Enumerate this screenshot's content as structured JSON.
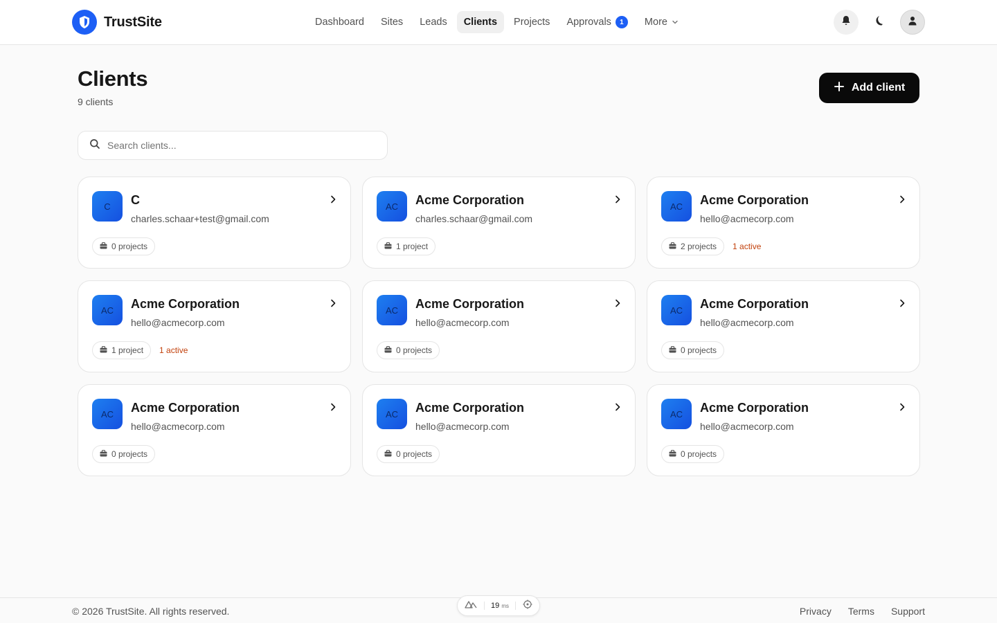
{
  "brand": {
    "name": "TrustSite",
    "accent": "#1d5ff5"
  },
  "nav": {
    "items": [
      {
        "label": "Dashboard",
        "active": false
      },
      {
        "label": "Sites",
        "active": false
      },
      {
        "label": "Leads",
        "active": false
      },
      {
        "label": "Clients",
        "active": true
      },
      {
        "label": "Projects",
        "active": false
      },
      {
        "label": "Approvals",
        "active": false,
        "badge": "1"
      },
      {
        "label": "More",
        "active": false,
        "dropdown": true
      }
    ]
  },
  "header_icons": [
    "bell-icon",
    "moon-icon",
    "user-icon"
  ],
  "page": {
    "title": "Clients",
    "count": "9 clients",
    "add_button": "Add client",
    "search_placeholder": "Search clients..."
  },
  "clients": [
    {
      "initials": "C",
      "name": "C",
      "email": "charles.schaar+test@gmail.com",
      "projects": "0 projects",
      "active": ""
    },
    {
      "initials": "AC",
      "name": "Acme Corporation",
      "email": "charles.schaar@gmail.com",
      "projects": "1 project",
      "active": ""
    },
    {
      "initials": "AC",
      "name": "Acme Corporation",
      "email": "hello@acmecorp.com",
      "projects": "2 projects",
      "active": "1 active"
    },
    {
      "initials": "AC",
      "name": "Acme Corporation",
      "email": "hello@acmecorp.com",
      "projects": "1 project",
      "active": "1 active"
    },
    {
      "initials": "AC",
      "name": "Acme Corporation",
      "email": "hello@acmecorp.com",
      "projects": "0 projects",
      "active": ""
    },
    {
      "initials": "AC",
      "name": "Acme Corporation",
      "email": "hello@acmecorp.com",
      "projects": "0 projects",
      "active": ""
    },
    {
      "initials": "AC",
      "name": "Acme Corporation",
      "email": "hello@acmecorp.com",
      "projects": "0 projects",
      "active": ""
    },
    {
      "initials": "AC",
      "name": "Acme Corporation",
      "email": "hello@acmecorp.com",
      "projects": "0 projects",
      "active": ""
    },
    {
      "initials": "AC",
      "name": "Acme Corporation",
      "email": "hello@acmecorp.com",
      "projects": "0 projects",
      "active": ""
    }
  ],
  "footer": {
    "copyright": "© 2026 TrustSite. All rights reserved.",
    "links": [
      "Privacy",
      "Terms",
      "Support"
    ]
  },
  "devbar": {
    "ms_value": "19",
    "ms_unit": "ms"
  },
  "colors": {
    "active_text": "#c2410c",
    "primary_button": "#0a0a0a"
  }
}
